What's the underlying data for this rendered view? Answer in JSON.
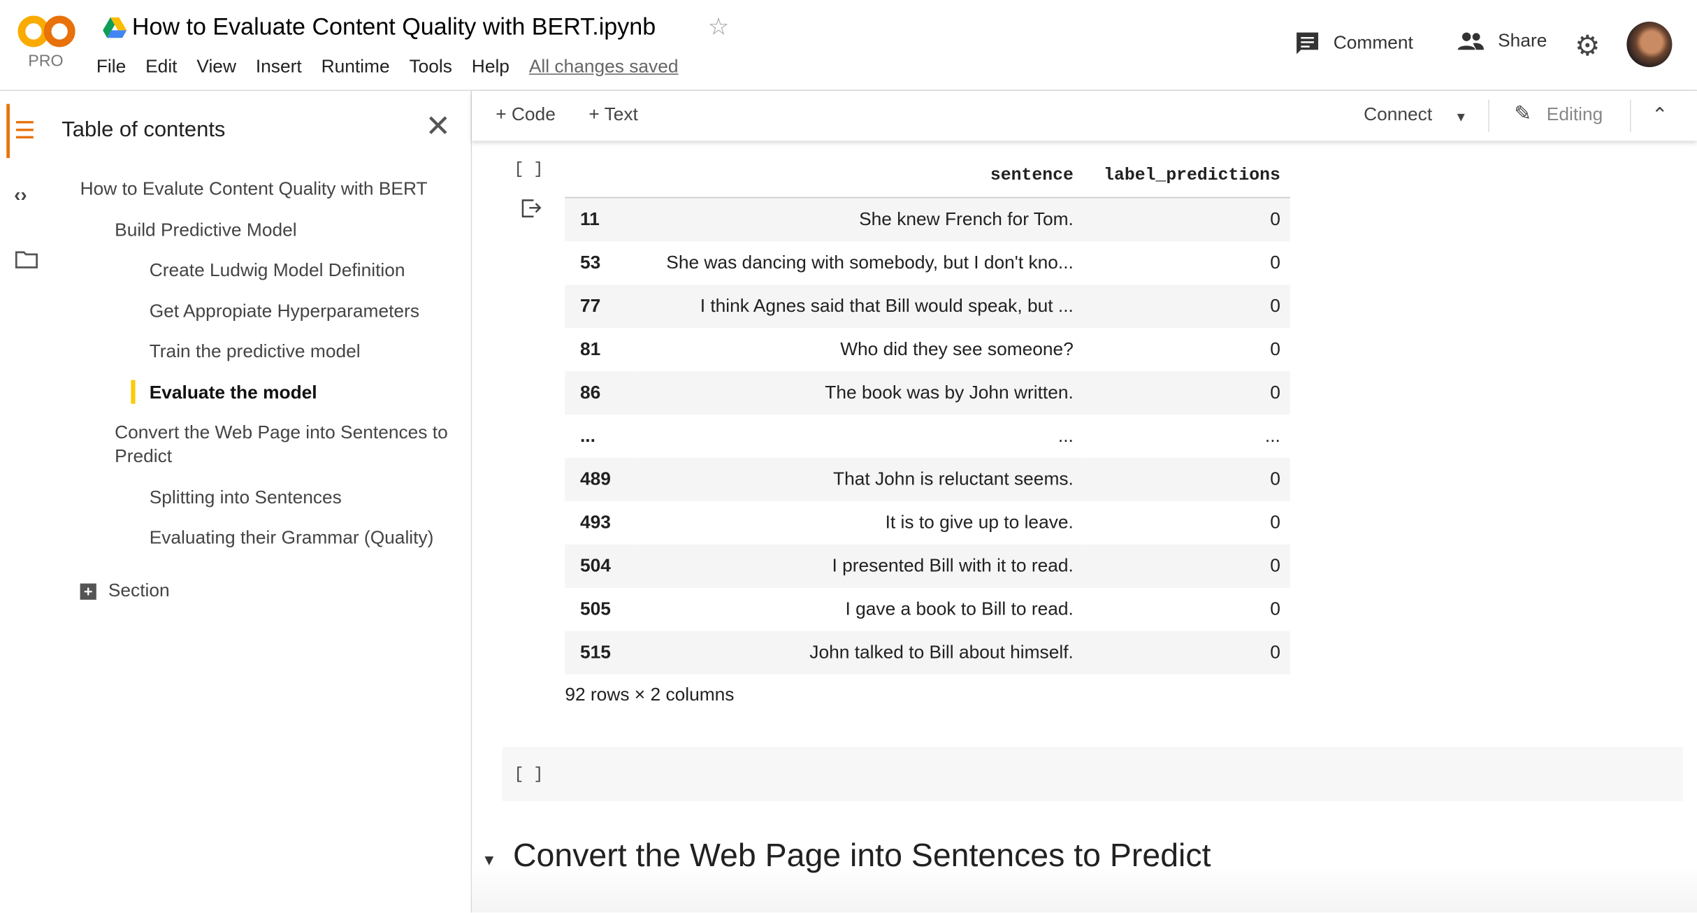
{
  "header": {
    "logo_text": "CO",
    "plan": "PRO",
    "title": "How to Evaluate Content Quality with BERT.ipynb",
    "menu": [
      "File",
      "Edit",
      "View",
      "Insert",
      "Runtime",
      "Tools",
      "Help"
    ],
    "save_status": "All changes saved",
    "comment": "Comment",
    "share": "Share"
  },
  "sidebar": {
    "title": "Table of contents",
    "items": [
      {
        "label": "How to Evalute Content Quality with BERT",
        "level": 1
      },
      {
        "label": "Build Predictive Model",
        "level": 2
      },
      {
        "label": "Create Ludwig Model Definition",
        "level": 3
      },
      {
        "label": "Get Appropiate Hyperparameters",
        "level": 3
      },
      {
        "label": "Train the predictive model",
        "level": 3
      },
      {
        "label": "Evaluate the model",
        "level": 3,
        "active": true
      },
      {
        "label": "Convert the Web Page into Sentences to Predict",
        "level": 2
      },
      {
        "label": "Splitting into Sentences",
        "level": 3
      },
      {
        "label": "Evaluating their Grammar (Quality)",
        "level": 3
      }
    ],
    "add_section": "Section"
  },
  "toolbar": {
    "code": "+ Code",
    "text": "+ Text",
    "connect": "Connect",
    "editing": "Editing"
  },
  "cell": {
    "bracket": "[ ]"
  },
  "dataframe": {
    "columns": [
      "",
      "sentence",
      "label_predictions"
    ],
    "rows": [
      [
        "11",
        "She knew French for Tom.",
        "0"
      ],
      [
        "53",
        "She was dancing with somebody, but I don't kno...",
        "0"
      ],
      [
        "77",
        "I think Agnes said that Bill would speak, but ...",
        "0"
      ],
      [
        "81",
        "Who did they see someone?",
        "0"
      ],
      [
        "86",
        "The book was by John written.",
        "0"
      ],
      [
        "...",
        "...",
        "..."
      ],
      [
        "489",
        "That John is reluctant seems.",
        "0"
      ],
      [
        "493",
        "It is to give up to leave.",
        "0"
      ],
      [
        "504",
        "I presented Bill with it to read.",
        "0"
      ],
      [
        "505",
        "I gave a book to Bill to read.",
        "0"
      ],
      [
        "515",
        "John talked to Bill about himself.",
        "0"
      ]
    ],
    "shape": "92 rows × 2 columns"
  },
  "section_heading": "Convert the Web Page into Sentences to Predict",
  "colors": {
    "accent": "#e8710a",
    "logo": "#f9ab00",
    "active_marker": "#fbcb0a"
  }
}
